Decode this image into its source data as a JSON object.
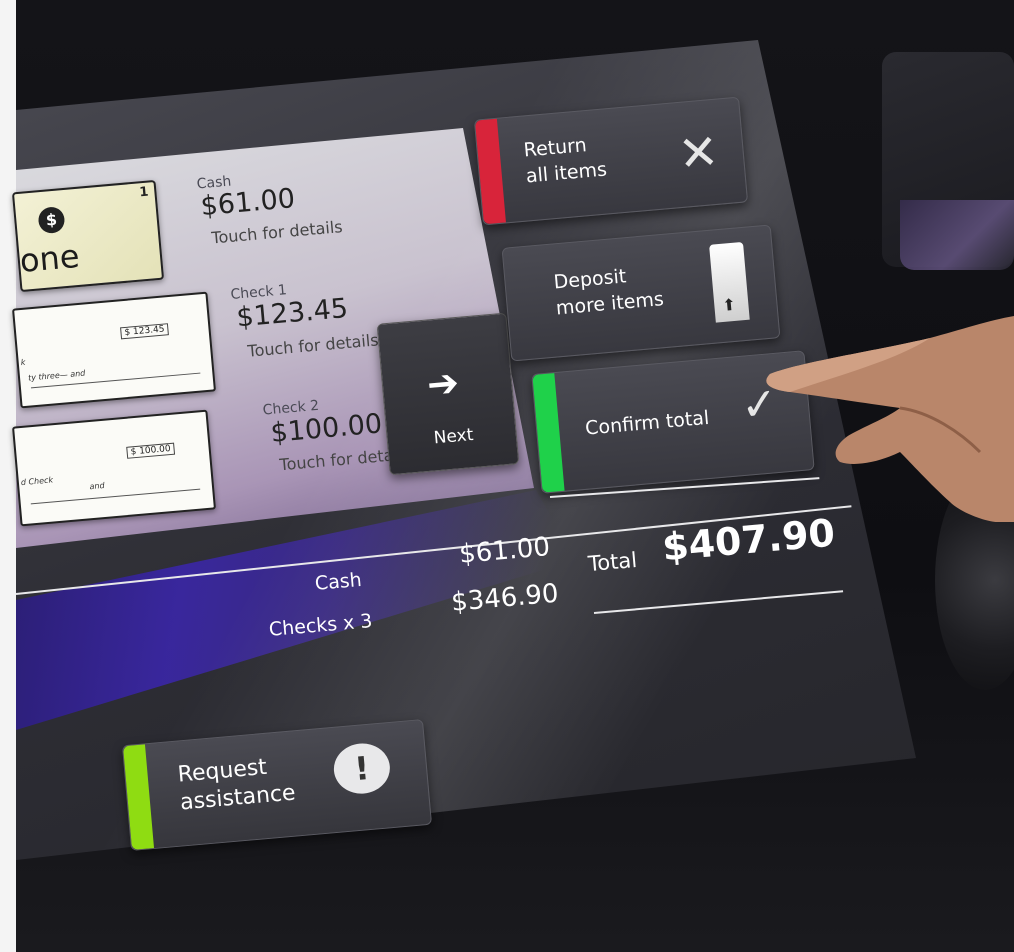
{
  "items": {
    "cash": {
      "badge": "$",
      "count": "1",
      "card_word": "one",
      "label": "Cash",
      "amount": "$61.00",
      "action": "Touch for details"
    },
    "check1": {
      "label": "Check 1",
      "amount": "$123.45",
      "action": "Touch for details",
      "card_amount": "$ 123.45",
      "card_text": "ty three— and",
      "card_prefix": "k"
    },
    "check2": {
      "label": "Check 2",
      "amount": "$100.00",
      "action": "Touch for details",
      "card_amount": "$ 100.00",
      "card_text": "and",
      "card_prefix": "d Check"
    }
  },
  "nav": {
    "next_label": "Next",
    "next_icon": "arrow-right-icon"
  },
  "actions": {
    "return_label_line1": "Return",
    "return_label_line2": "all items",
    "deposit_label_line1": "Deposit",
    "deposit_label_line2": "more items",
    "confirm_label": "Confirm total",
    "assist_label_line1": "Request",
    "assist_label_line2": "assistance"
  },
  "summary": {
    "cash_label": "Cash",
    "cash_value": "$61.00",
    "checks_label": "Checks x 3",
    "checks_value": "$346.90",
    "total_label": "Total",
    "total_value": "$407.90"
  },
  "colors": {
    "return_accent": "#d8243a",
    "confirm_accent": "#1fd14a",
    "assist_accent": "#8fdc12",
    "panel_purple": "#3a26a8"
  }
}
